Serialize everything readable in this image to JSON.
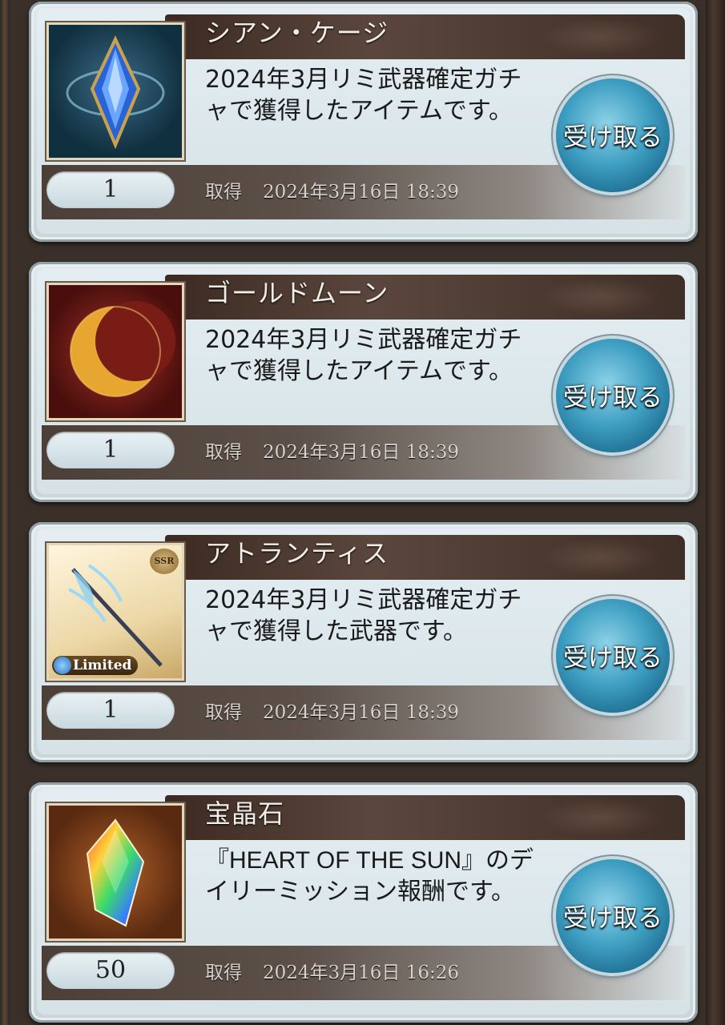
{
  "receive_label": "受け取る",
  "acquired_label": "取得",
  "items": [
    {
      "name": "シアン・ケージ",
      "desc": "2024年3月リミ武器確定ガチャで獲得したアイテムです。",
      "qty": "1",
      "date": "2024年3月16日 18:39",
      "icon": "blue-crystal-icon"
    },
    {
      "name": "ゴールドムーン",
      "desc": "2024年3月リミ武器確定ガチャで獲得したアイテムです。",
      "qty": "1",
      "date": "2024年3月16日 18:39",
      "icon": "gold-moon-icon"
    },
    {
      "name": "アトランティス",
      "desc": "2024年3月リミ武器確定ガチャで獲得した武器です。",
      "qty": "1",
      "date": "2024年3月16日 18:39",
      "icon": "weapon-atlantis-icon",
      "rarity": "SSR",
      "tag": "Limited"
    },
    {
      "name": "宝晶石",
      "desc": "『HEART OF THE SUN』のデイリーミッション報酬です。",
      "qty": "50",
      "date": "2024年3月16日 16:26",
      "icon": "crystal-gem-icon"
    }
  ],
  "colors": {
    "title_band": "#3c2a22",
    "button": "#3f9fc2",
    "card": "#dfe8ea"
  }
}
